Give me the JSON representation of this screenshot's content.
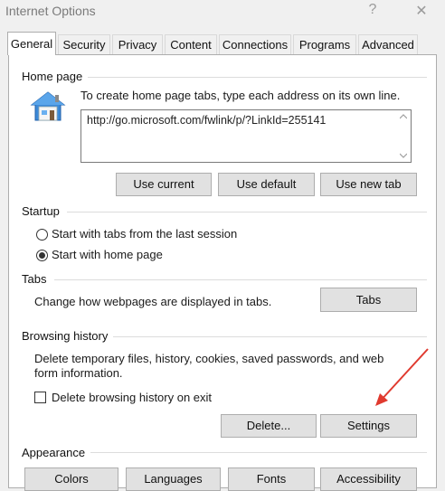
{
  "window": {
    "title": "Internet Options",
    "help_glyph": "?",
    "close_glyph": "✕"
  },
  "tabs": [
    {
      "label": "General",
      "active": true
    },
    {
      "label": "Security",
      "active": false
    },
    {
      "label": "Privacy",
      "active": false
    },
    {
      "label": "Content",
      "active": false
    },
    {
      "label": "Connections",
      "active": false
    },
    {
      "label": "Programs",
      "active": false
    },
    {
      "label": "Advanced",
      "active": false
    }
  ],
  "home_page": {
    "group_label": "Home page",
    "instruction": "To create home page tabs, type each address on its own line.",
    "url_value": "http://go.microsoft.com/fwlink/p/?LinkId=255141",
    "use_current": "Use current",
    "use_default": "Use default",
    "use_new_tab": "Use new tab"
  },
  "startup": {
    "group_label": "Startup",
    "option_last_session": "Start with tabs from the last session",
    "option_home_page": "Start with home page",
    "selected": "home_page"
  },
  "tabs_section": {
    "group_label": "Tabs",
    "description": "Change how webpages are displayed in tabs.",
    "button": "Tabs"
  },
  "browsing_history": {
    "group_label": "Browsing history",
    "description_line1": "Delete temporary files, history, cookies, saved passwords, and web",
    "description_line2": "form information.",
    "delete_on_exit_label": "Delete browsing history on exit",
    "delete_on_exit_checked": false,
    "delete_button": "Delete...",
    "settings_button": "Settings"
  },
  "appearance": {
    "group_label": "Appearance",
    "colors": "Colors",
    "languages": "Languages",
    "fonts": "Fonts",
    "accessibility": "Accessibility"
  },
  "colors": {
    "arrow": "#e03a2f",
    "accent": "#1e73c8"
  }
}
